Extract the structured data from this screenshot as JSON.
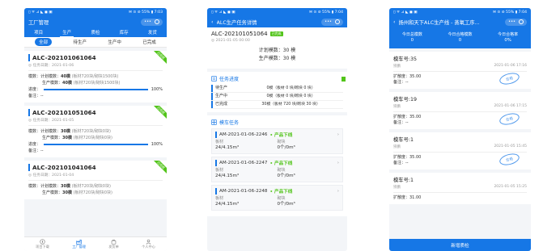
{
  "status_bar": {
    "left": "▯ ᯤ ⊿ ◣ ◼ ▣",
    "right_p1": "✉ ⊙ ⊘ 55% ▮ 7:03",
    "right_p2": "✉ ⊙ ⊘ 55% ▮ 7:04",
    "right_p3": "✉ ⊙ ⊘ 55% ▮ 7:04"
  },
  "p1": {
    "title": "工厂管理",
    "menu": "•••",
    "tabs": [
      "项目",
      "生产",
      "质检",
      "库存",
      "发货"
    ],
    "subtabs": [
      "全部",
      "待生产",
      "生产中",
      "已完成"
    ],
    "cards": [
      {
        "title": "ALC-202101061064",
        "date": "◎ 任务日期：2021-01-06",
        "ribbon": "已完成",
        "r1": "模数：计划模数：",
        "r1b": "40模",
        "r1c": "(板材720块/砌块1500块)",
        "r2": "生产模数：",
        "r2b": "40模",
        "r2c": "(板材720块/砌块1500块)",
        "progress_label": "进度：",
        "progress_text": "100%",
        "progress": 1.0,
        "note": "备注：--"
      },
      {
        "title": "ALC-202101051064",
        "date": "◎ 任务日期：2021-01-05",
        "ribbon": "已完成",
        "r1": "模数：计划模数：",
        "r1b": "30模",
        "r1c": "(板材720块/砌块0块)",
        "r2": "生产模数：",
        "r2b": "30模",
        "r2c": "(板材720块/砌块0块)",
        "progress_label": "进度：",
        "progress_text": "100%",
        "progress": 1.0,
        "note": "备注：--"
      },
      {
        "title": "ALC-202101041064",
        "date": "◎ 任务日期：2021-01-04",
        "ribbon": "已完成",
        "r1": "模数：计划模数：",
        "r1b": "30模",
        "r1c": "(板材720块/砌块0块)",
        "r2": "生产模数：",
        "r2b": "30模",
        "r2c": "(板材720块/砌块0块)"
      }
    ],
    "nav": [
      "项目下载",
      "工厂管理",
      "发货单",
      "个人中心"
    ]
  },
  "p2": {
    "title": "ALC生产任务详情",
    "menu": "•••",
    "code": "ALC-202101051064",
    "badge": "已完成",
    "date": "◎ 2021-01-05 00:00",
    "plan": "计划模数：30 模",
    "prod": "生产模数：30 模",
    "progress_title": "任务进度",
    "rows": [
      {
        "label": "待生产",
        "value": "0模（板材 0 块/砌块 0 块）"
      },
      {
        "label": "生产中",
        "value": "0模（板材 0 块/砌块 0 块）"
      },
      {
        "label": "已完成",
        "value": "30模（板材 720 块/砌块 30 块）"
      }
    ],
    "tasks_title": "模车任务",
    "tasks": [
      {
        "id": "AM-2021-01-06-2246",
        "status": "产品下线",
        "l1": "板材",
        "l2": "砌块",
        "v1": "24/4.15m³",
        "v2": "0个/0m³"
      },
      {
        "id": "AM-2021-01-06-2247",
        "status": "产品下线",
        "l1": "板材",
        "l2": "砌块",
        "v1": "24/4.15m³",
        "v2": "0个/0m³"
      },
      {
        "id": "AM-2021-01-06-2248",
        "status": "产品下线",
        "l1": "板材",
        "l2": "砌块",
        "v1": "24/4.15m³",
        "v2": "0个/0m³"
      }
    ]
  },
  "p3": {
    "title": "扬州和天下ALC生产线 - 蒸氧工序...",
    "menu": "•••",
    "stats": [
      {
        "label": "今日总模数",
        "value": "0"
      },
      {
        "label": "今日合格模数",
        "value": "0"
      },
      {
        "label": "今日合格率",
        "value": "0%"
      }
    ],
    "items": [
      {
        "name": "模车号:35",
        "who": "崇鹏",
        "time": "2021-01-06 17:16",
        "exp": "扩散度：35.00",
        "note": "备注：--",
        "stamp": "合格"
      },
      {
        "name": "模车号:19",
        "who": "崇鹏",
        "time": "2021-01-06 17:15",
        "exp": "扩散度：35.00",
        "note": "备注：--",
        "stamp": "合格"
      },
      {
        "name": "模车号:1",
        "who": "崇鹏",
        "time": "2021-01-05 15:45",
        "exp": "扩散度：35.00",
        "note": "备注：--",
        "stamp": "合格"
      },
      {
        "name": "模车号:1",
        "who": "崇鹏",
        "time": "2021-01-05 15:25",
        "exp": "扩散度：31.00",
        "note": "",
        "stamp": ""
      }
    ],
    "button": "新增质检"
  },
  "colors": {
    "primary": "#1677e6",
    "success": "#52c41a",
    "background": "#f3f5f8"
  }
}
